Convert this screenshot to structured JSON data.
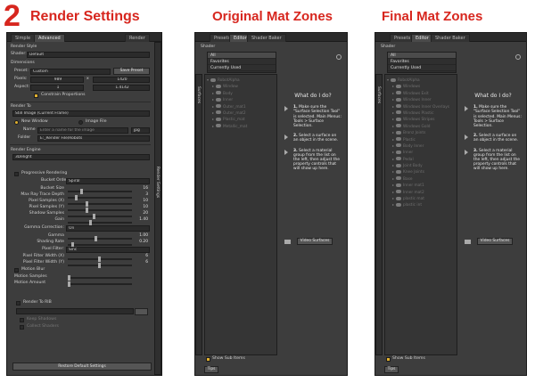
{
  "headings": {
    "number": "2",
    "render": "Render Settings",
    "original": "Original Mat Zones",
    "final": "Final Mat Zones"
  },
  "render_panel": {
    "tabs": [
      "Simple",
      "Advanced",
      "Render"
    ],
    "render_style_label": "Render Style",
    "shader_label": "Shader:",
    "shader_value": "Default",
    "dimensions_label": "Dimensions",
    "preset_label": "Preset:",
    "preset_value": "Custom",
    "save_preset": "Save Preset",
    "pixels_label": "Pixels:",
    "width": "989",
    "x_sep": "x",
    "height": "1420",
    "aspect_label": "Aspect:",
    "aspect_w": "1",
    "aspect_h": "1.4142",
    "constrain": "Constrain Proportions",
    "render_to_label": "Render To",
    "render_to_value": "Still Image (Current Frame)",
    "new_window": "New Window",
    "image_file": "Image File",
    "name_label": "Name",
    "name_placeholder": "Enter a name for the image",
    "format": "jpg",
    "folder_label": "Folder",
    "folder_value": "E:_Render File/Robots",
    "engine_label": "Render Engine",
    "engine_value": "3Delight",
    "progressive": "Progressive Rendering",
    "bucket_order_label": "Bucket Order:",
    "bucket_order_value": "Spiral",
    "sliders": [
      {
        "label": "Bucket Size",
        "value": "16"
      },
      {
        "label": "Max Ray Trace Depth",
        "value": "3"
      },
      {
        "label": "Pixel Samples (X)",
        "value": "10"
      },
      {
        "label": "Pixel Samples (Y)",
        "value": "10"
      },
      {
        "label": "Shadow Samples",
        "value": "20"
      },
      {
        "label": "Gain",
        "value": "1.40"
      }
    ],
    "gamma_correction_label": "Gamma Correction:",
    "gamma_correction_value": "On",
    "gamma_label": "Gamma",
    "gamma_value": "1.00",
    "shading_rate_label": "Shading Rate",
    "shading_rate_value": "0.20",
    "pixel_filter_label": "Pixel Filter:",
    "pixel_filter_value": "Sinc",
    "filter_w_label": "Pixel Filter Width (X)",
    "filter_w_value": "6",
    "filter_h_label": "Pixel Filter Width (Y)",
    "filter_h_value": "6",
    "motion_blur": "Motion Blur",
    "motion_samples": "Motion Samples",
    "motion_amount": "Motion Amount",
    "render_to_rib": "Render To RIB",
    "rib_opt1": "Keep Shadows",
    "rib_opt2": "Collect Shaders",
    "restore": "Restore Default Settings",
    "side_tab": "Render Settings"
  },
  "orig_panel": {
    "tabs": [
      "Presets",
      "Editor",
      "Shader Baker"
    ],
    "shader_label": "Shader",
    "list": [
      "All",
      "Favorites",
      "Currently Used"
    ],
    "side_tab": "Surfaces",
    "tree_root": "RobotAlpha",
    "tree": [
      "Window",
      "Body",
      "Inner",
      "Outer_mat1",
      "Outer_mat2",
      "Plastic_mat",
      "Metallic_mat"
    ],
    "show_sub": "Show Sub Items",
    "tips": "Tips",
    "help_title": "What do I do?",
    "steps": [
      {
        "num": "1.",
        "text": "Make sure the \"Surface Selection Tool\" is selected. Main Menus: Tools > Surface Selection."
      },
      {
        "num": "2.",
        "text": "Select a surface on an object in the scene."
      },
      {
        "num": "3.",
        "text": "Select a material group from the list on the left, then adjust the property controls that will show up here."
      }
    ],
    "video_btn": "Video Surfaces"
  },
  "final_panel": {
    "tabs": [
      "Presets",
      "Editor",
      "Shader Baker"
    ],
    "shader_label": "Shader",
    "list": [
      "All",
      "Favorites",
      "Currently Used"
    ],
    "side_tab": "Surfaces",
    "tree_root": "RobotAlpha",
    "tree": [
      "Windows",
      "Windows Exit",
      "Windows Inner",
      "Windows Inner Overlays",
      "Windows Plastic",
      "Windows Stripes",
      "Windows Gold",
      "Bronz Joints",
      "Plastic",
      "Body Inner",
      "Inner",
      "Pedal",
      "Joint Body",
      "Knee Joints",
      "Base",
      "Inner mat1",
      "Inner mat2",
      "plastic mat",
      "plastic int"
    ],
    "show_sub": "Show Sub Items",
    "tips": "Tips",
    "help_title": "What do I do?",
    "steps": [
      {
        "num": "1.",
        "text": "Make sure the \"Surface Selection Tool\" is selected. Main Menus: Tools > Surface Selection."
      },
      {
        "num": "2.",
        "text": "Select a surface on an object in the scene."
      },
      {
        "num": "3.",
        "text": "Select a material group from the list on the left, then adjust the property controls that will show up here."
      }
    ],
    "video_btn": "Video Surfaces"
  }
}
